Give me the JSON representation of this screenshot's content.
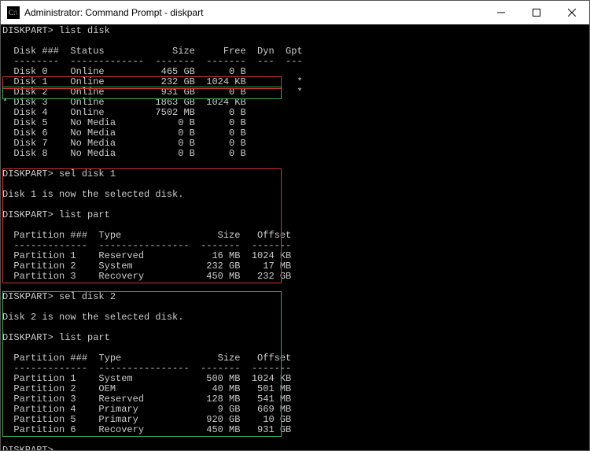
{
  "titlebar": {
    "title": "Administrator: Command Prompt - diskpart"
  },
  "prompts": {
    "diskpart": "DISKPART>",
    "list_disk": "list disk",
    "sel_disk1": "sel disk 1",
    "sel_disk2": "sel disk 2",
    "list_part": "list part",
    "disk1_selected": "Disk 1 is now the selected disk.",
    "disk2_selected": "Disk 2 is now the selected disk."
  },
  "disk_header": {
    "col1": "Disk ###",
    "col2": "Status",
    "col3": "Size",
    "col4": "Free",
    "col5": "Dyn",
    "col6": "Gpt",
    "rule": "--------  -------------  -------  -------  ---  ---"
  },
  "disks": [
    {
      "sel": " ",
      "num": "Disk 0",
      "status": "Online",
      "size": "465 GB",
      "free": "0 B",
      "dyn": " ",
      "gpt": " "
    },
    {
      "sel": " ",
      "num": "Disk 1",
      "status": "Online",
      "size": "232 GB",
      "free": "1024 KB",
      "dyn": " ",
      "gpt": "*"
    },
    {
      "sel": " ",
      "num": "Disk 2",
      "status": "Online",
      "size": "931 GB",
      "free": "0 B",
      "dyn": " ",
      "gpt": "*"
    },
    {
      "sel": "*",
      "num": "Disk 3",
      "status": "Online",
      "size": "1863 GB",
      "free": "1024 KB",
      "dyn": " ",
      "gpt": " "
    },
    {
      "sel": " ",
      "num": "Disk 4",
      "status": "Online",
      "size": "7502 MB",
      "free": "0 B",
      "dyn": " ",
      "gpt": " "
    },
    {
      "sel": " ",
      "num": "Disk 5",
      "status": "No Media",
      "size": "0 B",
      "free": "0 B",
      "dyn": " ",
      "gpt": " "
    },
    {
      "sel": " ",
      "num": "Disk 6",
      "status": "No Media",
      "size": "0 B",
      "free": "0 B",
      "dyn": " ",
      "gpt": " "
    },
    {
      "sel": " ",
      "num": "Disk 7",
      "status": "No Media",
      "size": "0 B",
      "free": "0 B",
      "dyn": " ",
      "gpt": " "
    },
    {
      "sel": " ",
      "num": "Disk 8",
      "status": "No Media",
      "size": "0 B",
      "free": "0 B",
      "dyn": " ",
      "gpt": " "
    }
  ],
  "part_header": {
    "col1": "Partition ###",
    "col2": "Type",
    "col3": "Size",
    "col4": "Offset",
    "rule": "-------------  ----------------  -------  -------"
  },
  "parts1": [
    {
      "num": "Partition 1",
      "type": "Reserved",
      "size": "16 MB",
      "off": "1024 KB"
    },
    {
      "num": "Partition 2",
      "type": "System",
      "size": "232 GB",
      "off": "17 MB"
    },
    {
      "num": "Partition 3",
      "type": "Recovery",
      "size": "450 MB",
      "off": "232 GB"
    }
  ],
  "parts2": [
    {
      "num": "Partition 1",
      "type": "System",
      "size": "500 MB",
      "off": "1024 KB"
    },
    {
      "num": "Partition 2",
      "type": "OEM",
      "size": "40 MB",
      "off": "501 MB"
    },
    {
      "num": "Partition 3",
      "type": "Reserved",
      "size": "128 MB",
      "off": "541 MB"
    },
    {
      "num": "Partition 4",
      "type": "Primary",
      "size": "9 GB",
      "off": "669 MB"
    },
    {
      "num": "Partition 5",
      "type": "Primary",
      "size": "920 GB",
      "off": "10 GB"
    },
    {
      "num": "Partition 6",
      "type": "Recovery",
      "size": "450 MB",
      "off": "931 GB"
    }
  ]
}
